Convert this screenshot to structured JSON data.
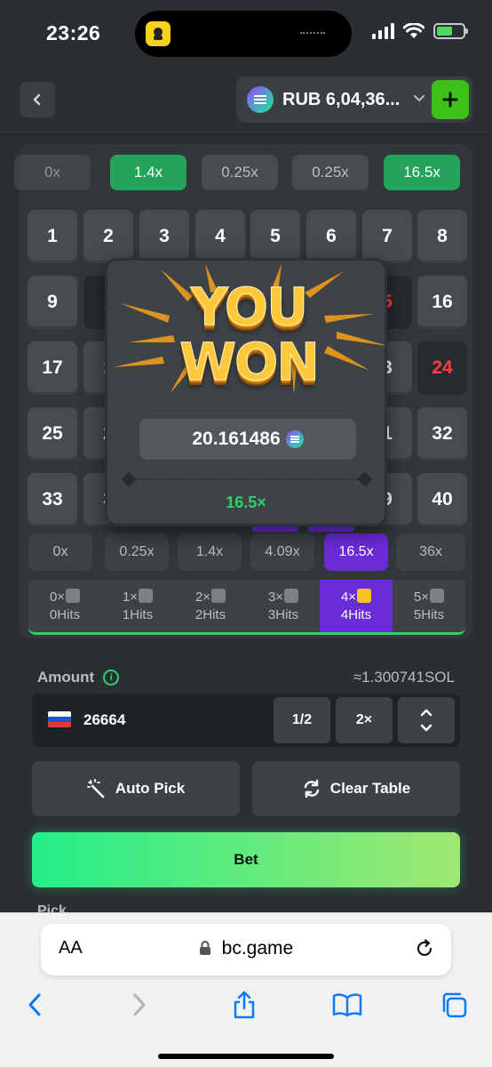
{
  "status_bar": {
    "time": "23:26"
  },
  "header": {
    "wallet_label": "RUB 6,04,36...",
    "plus_label": "+"
  },
  "multiplier_chips": [
    "0x",
    "1.4x",
    "0.25x",
    "0.25x",
    "16.5x"
  ],
  "grid": {
    "cells": [
      "1",
      "2",
      "3",
      "4",
      "5",
      "6",
      "7",
      "8",
      "9",
      "1",
      "5",
      "16",
      "17",
      "1",
      "3",
      "24",
      "25",
      "2",
      "1",
      "32",
      "33",
      "3",
      "9",
      "40"
    ]
  },
  "payouts": {
    "items": [
      "0x",
      "0.25x",
      "1.4x",
      "4.09x",
      "16.5x",
      "36x"
    ],
    "active_index": 4
  },
  "hits": {
    "items": [
      {
        "top": "0×",
        "bottom": "0Hits"
      },
      {
        "top": "1×",
        "bottom": "1Hits"
      },
      {
        "top": "2×",
        "bottom": "2Hits"
      },
      {
        "top": "3×",
        "bottom": "3Hits"
      },
      {
        "top": "4×",
        "bottom": "4Hits"
      },
      {
        "top": "5×",
        "bottom": "5Hits"
      }
    ],
    "active_index": 4
  },
  "popup": {
    "line1": "YOU",
    "line2": "WON",
    "amount": "20.161486",
    "multiplier": "16.5×"
  },
  "controls": {
    "amount_label": "Amount",
    "info": "i",
    "sol_estimate": "≈1.300741SOL",
    "amount_value": "26664",
    "half_label": "1/2",
    "double_label": "2×",
    "auto_pick_label": "Auto Pick",
    "clear_table_label": "Clear Table",
    "bet_label": "Bet",
    "pick_label": "Pick"
  },
  "browser": {
    "text_size_label": "AA",
    "url": "bc.game"
  },
  "colors": {
    "accent_green": "#24a35a",
    "active_purple": "#6a2bd9",
    "bet_gradient_start": "#24ee89",
    "bet_gradient_end": "#9fe871",
    "red_number": "#ff3e3e"
  }
}
